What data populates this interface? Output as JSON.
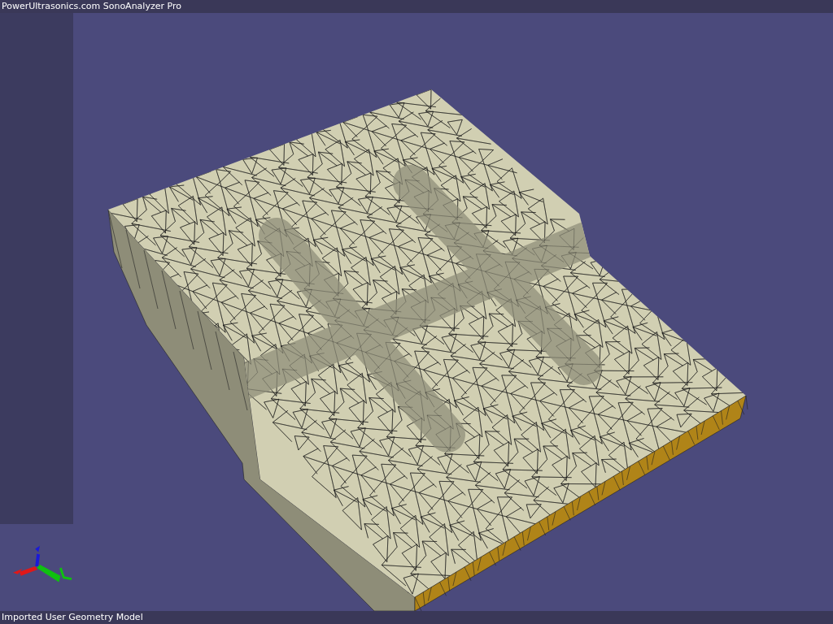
{
  "window": {
    "title": "PowerUltrasonics.com SonoAnalyzer Pro"
  },
  "status_bar": {
    "text": "Imported User Geometry Model"
  }
}
